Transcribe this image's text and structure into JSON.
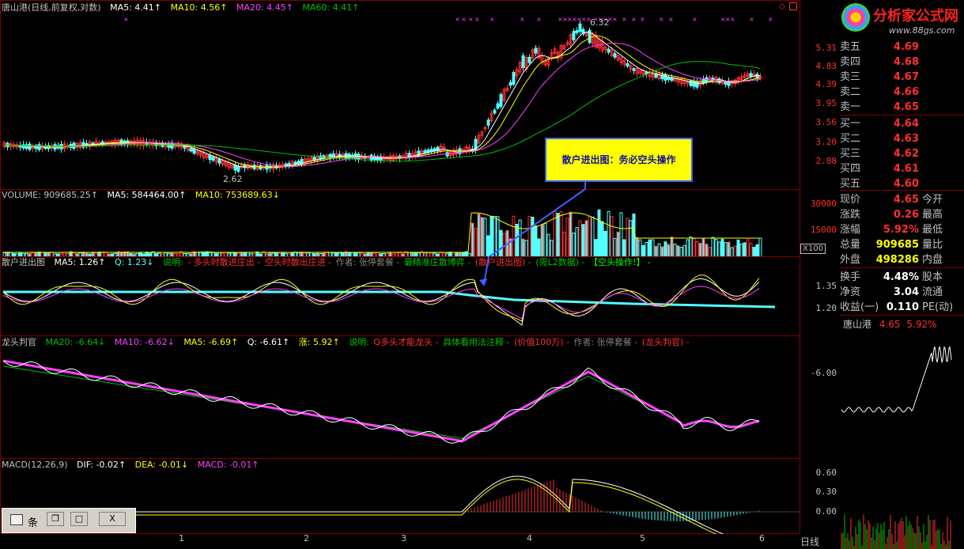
{
  "main_header": {
    "title": "唐山港(日线,前复权,对数)",
    "ma5": "MA5: 4.41↑",
    "ma10": "MA10: 4.56↑",
    "ma20": "MA20: 4.45↑",
    "ma60": "MA60: 4.41↑"
  },
  "price_axis": [
    "5.31",
    "4.83",
    "4.39",
    "3.95",
    "3.56",
    "3.20",
    "2.88"
  ],
  "price_labels": {
    "high": "6.32",
    "low": "2.62"
  },
  "vol_header": {
    "title": "VOLUME: 909685.25↑",
    "ma5": "MA5: 584464.00↑",
    "ma10": "MA10: 753689.63↓"
  },
  "vol_axis": [
    "30000",
    "15000"
  ],
  "vol_unit": "X100",
  "sanhu_header": {
    "title": "散户进出图",
    "ma5": "MA5: 1.26↑",
    "q": "Q: 1.23↓",
    "note_label": "说明:",
    "note1": "- 多头时散进庄出 -",
    "note2": "空头时散出庄进 -",
    "author": "作者: 张停套餐 -",
    "note3": "最精准庄散博弈 -",
    "note4": "(散户进出图) -",
    "note5": "(需L2数据) -",
    "note6": "【空头操作!】 -"
  },
  "sanhu_axis": [
    "1.35",
    "1.20"
  ],
  "longtou_header": {
    "title": "龙头判官",
    "ma20": "MA20: -6.64↓",
    "ma10": "MA10: -6.62↓",
    "ma5": "MA5: -6.69↑",
    "q": "Q: -6.61↑",
    "zhang": "涨: 5.92↑",
    "note_label": "说明:",
    "note1": "Q多头才能龙头 -",
    "note2": "具体看用法注释 -",
    "note3": "(价值100万) -",
    "author": "作者: 张停套餐 -",
    "note4": "(龙头判官) -"
  },
  "longtou_axis": [
    "-6.00"
  ],
  "macd_header": {
    "title": "MACD(12,26,9)",
    "dif": "DIF: -0.02↑",
    "dea": "DEA: -0.01↓",
    "macd": "MACD: -0.01↑"
  },
  "macd_axis": [
    "0.60",
    "0.30",
    "0.00"
  ],
  "x_axis": [
    "1",
    "2",
    "3",
    "4",
    "5",
    "6"
  ],
  "callout": "散户进出图：务必空头操作",
  "logo": {
    "title": "分析家公式网",
    "url": "www.88gs.com"
  },
  "quote": {
    "asks": [
      {
        "label": "卖五",
        "price": "4.69"
      },
      {
        "label": "卖四",
        "price": "4.68"
      },
      {
        "label": "卖三",
        "price": "4.67"
      },
      {
        "label": "卖二",
        "price": "4.66"
      },
      {
        "label": "卖一",
        "price": "4.65"
      }
    ],
    "bids": [
      {
        "label": "买一",
        "price": "4.64"
      },
      {
        "label": "买二",
        "price": "4.63"
      },
      {
        "label": "买三",
        "price": "4.62"
      },
      {
        "label": "买四",
        "price": "4.61"
      },
      {
        "label": "买五",
        "price": "4.60"
      }
    ],
    "stats": [
      {
        "label": "现价",
        "value": "4.65",
        "label2": "今开"
      },
      {
        "label": "涨跌",
        "value": "0.26",
        "label2": "最高"
      },
      {
        "label": "涨幅",
        "value": "5.92%",
        "label2": "最低"
      },
      {
        "label": "总量",
        "value": "909685",
        "label2": "量比"
      },
      {
        "label": "外盘",
        "value": "498286",
        "label2": "内盘"
      }
    ],
    "extra": [
      {
        "label": "换手",
        "value": "4.48%",
        "label2": "股本"
      },
      {
        "label": "净资",
        "value": "3.04",
        "label2": "流通"
      },
      {
        "label": "收益(一)",
        "value": "0.110",
        "label2": "PE(动)"
      }
    ],
    "mini_title": "唐山港",
    "mini_price": "4.65",
    "mini_pct": "5.92%",
    "period": "日线"
  },
  "dialog": {
    "label": "条",
    "close": "X"
  },
  "colors": {
    "up": "#ff3030",
    "down": "#54ffff",
    "ma5": "#ffffff",
    "ma10": "#ffff00",
    "ma20": "#ff40ff",
    "ma60": "#00c000"
  }
}
